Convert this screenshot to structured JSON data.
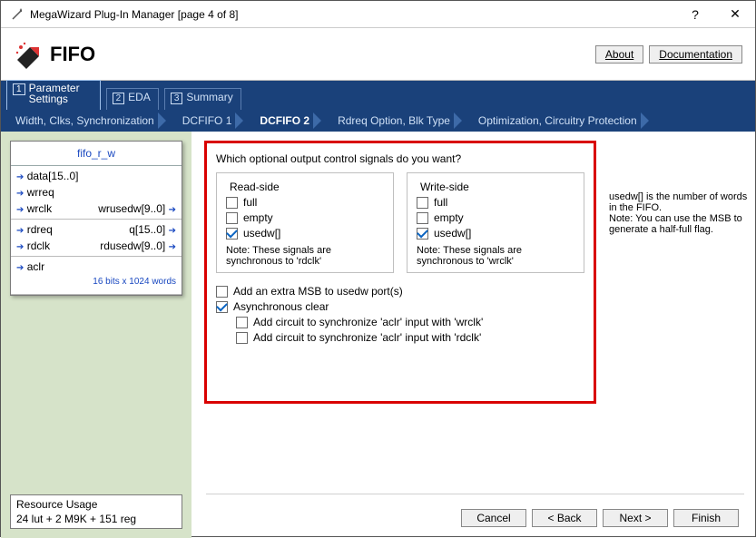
{
  "window": {
    "title": "MegaWizard Plug-In Manager [page 4 of 8]"
  },
  "header": {
    "name": "FIFO",
    "about": "About",
    "doc": "Documentation"
  },
  "tabs1": [
    {
      "num": "1",
      "label": "Parameter Settings",
      "active": true
    },
    {
      "num": "2",
      "label": "EDA",
      "active": false
    },
    {
      "num": "3",
      "label": "Summary",
      "active": false
    }
  ],
  "tabs2": [
    {
      "label": "Width, Clks, Synchronization",
      "active": false
    },
    {
      "label": "DCFIFO 1",
      "active": false
    },
    {
      "label": "DCFIFO 2",
      "active": true
    },
    {
      "label": "Rdreq Option, Blk Type",
      "active": false
    },
    {
      "label": "Optimization, Circuitry Protection",
      "active": false
    }
  ],
  "diagram": {
    "title": "fifo_r_w",
    "rows": [
      [
        "data[15..0]",
        ""
      ],
      [
        "wrreq",
        ""
      ],
      [
        "wrclk",
        "wrusedw[9..0]"
      ]
    ],
    "rows2": [
      [
        "rdreq",
        "q[15..0]"
      ],
      [
        "rdclk",
        "rdusedw[9..0]"
      ]
    ],
    "rows3": [
      [
        "aclr",
        ""
      ]
    ],
    "foot": "16 bits x 1024 words"
  },
  "resource": {
    "title": "Resource Usage",
    "value": "24 lut + 2 M9K + 151 reg"
  },
  "panel": {
    "question": "Which optional output control signals do you want?",
    "read": {
      "legend": "Read-side",
      "full": "full",
      "empty": "empty",
      "usedw": "usedw[]",
      "note": "Note: These signals are synchronous to 'rdclk'"
    },
    "write": {
      "legend": "Write-side",
      "full": "full",
      "empty": "empty",
      "usedw": "usedw[]",
      "note": "Note: These signals are synchronous to 'wrclk'"
    },
    "msb": "Add an extra MSB to usedw port(s)",
    "aclr": "Asynchronous clear",
    "sync_wr": "Add circuit to synchronize 'aclr' input with 'wrclk'",
    "sync_rd": "Add circuit to synchronize 'aclr' input with 'rdclk'",
    "hint": "usedw[] is the number of words in the FIFO.\nNote: You can use the MSB to generate a half-full flag."
  },
  "footer": {
    "cancel": "Cancel",
    "back": "< Back",
    "next": "Next >",
    "finish": "Finish"
  }
}
